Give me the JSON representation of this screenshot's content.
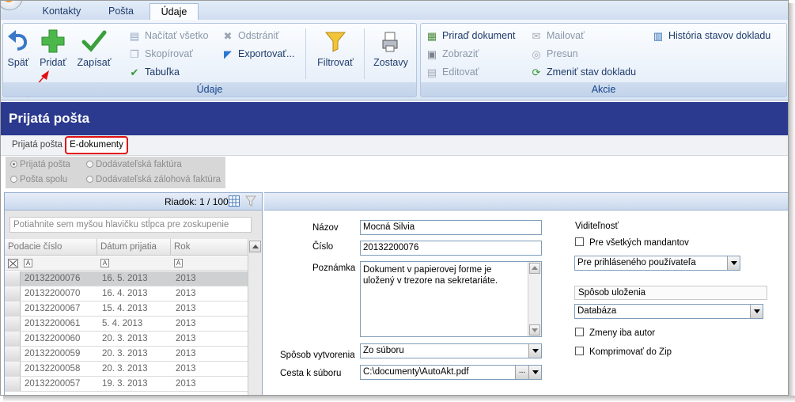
{
  "tabs": [
    {
      "label": "Kontakty",
      "active": false
    },
    {
      "label": "Pošta",
      "active": false
    },
    {
      "label": "Údaje",
      "active": true
    }
  ],
  "ribbon": {
    "udaje_group": {
      "label": "Údaje",
      "spat": "Späť",
      "pridat": "Pridať",
      "zapisat": "Zapísať",
      "nacitat_vsetko": "Načítať všetko",
      "skopirovat": "Skopírovať",
      "tabulka": "Tabuľka",
      "odstranit": "Odstrániť",
      "exportovat": "Exportovať...",
      "filtrovat": "Filtrovať",
      "zostavy": "Zostavy"
    },
    "akcie_group": {
      "label": "Akcie",
      "priradit_dokument": "Priraď dokument",
      "zobrazit": "Zobraziť",
      "editovat": "Editovať",
      "mailovat": "Mailovať",
      "presun": "Presun",
      "zmenit_stav": "Zmeniť stav dokladu",
      "historia": "História stavov dokladu"
    }
  },
  "page_title": "Prijatá pošta",
  "subtabs": {
    "prijata_posta": "Prijatá pošta",
    "e_dokumenty": "E-dokumenty"
  },
  "radios": {
    "prijata_posta": "Prijatá pošta",
    "posta_spolu": "Pošta spolu",
    "dodavatelska_faktura": "Dodávateľská faktúra",
    "dodavatelska_zalohova": "Dodávateľská zálohová faktúra"
  },
  "grid": {
    "row_indicator": "Riadok: 1 / 100",
    "group_hint": "Potiahnite sem myšou hlavičku stĺpca pre zoskupenie",
    "columns": [
      "Podacie číslo",
      "Dátum prijatia",
      "Rok"
    ],
    "rows": [
      [
        "20132200076",
        "16. 5. 2013",
        "2013"
      ],
      [
        "20132200070",
        "16. 4. 2013",
        "2013"
      ],
      [
        "20132200067",
        "15. 4. 2013",
        "2013"
      ],
      [
        "20132200061",
        "5. 4. 2013",
        "2013"
      ],
      [
        "20132200060",
        "20. 3. 2013",
        "2013"
      ],
      [
        "20132200059",
        "20. 3. 2013",
        "2013"
      ],
      [
        "20132200058",
        "20. 3. 2013",
        "2013"
      ],
      [
        "20132200057",
        "19. 3. 2013",
        "2013"
      ]
    ]
  },
  "form": {
    "nazov_label": "Názov",
    "nazov_value": "Mocná Silvia",
    "cislo_label": "Číslo",
    "cislo_value": "20132200076",
    "poznamka_label": "Poznámka",
    "poznamka_value": "Dokument v papierovej forme je uložený v trezore na sekretariáte.",
    "sposob_vytvorenia_label": "Spôsob vytvorenia",
    "sposob_vytvorenia_value": "Zo súboru",
    "cesta_label": "Cesta k súboru",
    "cesta_value": "C:\\documenty\\AutoAkt.pdf",
    "viditelnost_label": "Viditeľnosť",
    "pre_vsetkych": "Pre všetkých mandantov",
    "viditelnost_value": "Pre prihláseného používateľa",
    "sposob_ulozenia_label": "Spôsob uloženia",
    "sposob_ulozenia_value": "Databáza",
    "zmeny_iba_autor": "Zmeny iba autor",
    "komprimovat": "Komprimovať do Zip"
  },
  "colors": {
    "title_bar": "#2b3a8e",
    "highlight": "#e01010",
    "ribbon_text": "#1e3b6b"
  }
}
